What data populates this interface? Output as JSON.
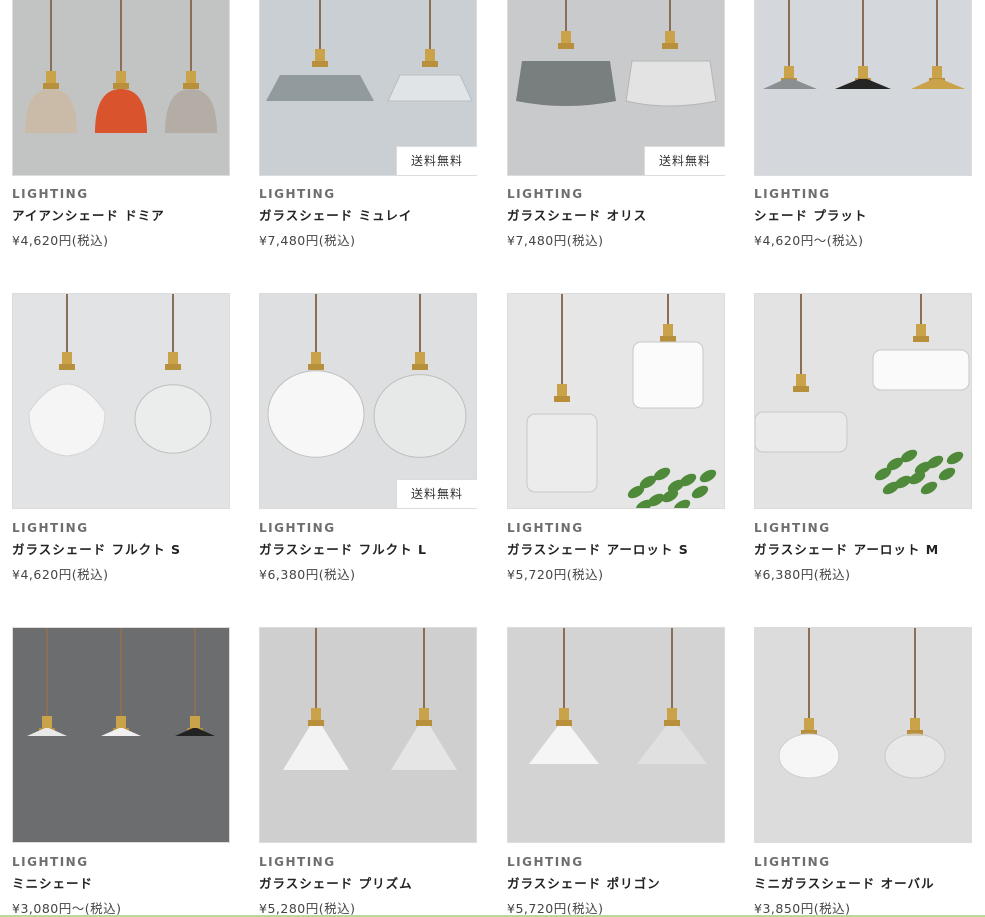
{
  "products": [
    {
      "category": "LIGHTING",
      "name": "アイアンシェード ドミア",
      "price": "¥4,620円(税込)",
      "badge": "",
      "scene": "iron",
      "bg": "#c2c4c4"
    },
    {
      "category": "LIGHTING",
      "name": "ガラスシェード ミュレイ",
      "price": "¥7,480円(税込)",
      "badge": "送料無料",
      "scene": "flat",
      "bg": "#c9cfd3"
    },
    {
      "category": "LIGHTING",
      "name": "ガラスシェード オリス",
      "price": "¥7,480円(税込)",
      "badge": "送料無料",
      "scene": "oris",
      "bg": "#c9cacc"
    },
    {
      "category": "LIGHTING",
      "name": "シェード プラット",
      "price": "¥4,620円〜(税込)",
      "badge": "",
      "scene": "plat",
      "bg": "#d4d8dc"
    },
    {
      "category": "LIGHTING",
      "name": "ガラスシェード フルクト S",
      "price": "¥4,620円(税込)",
      "badge": "",
      "scene": "frukt",
      "bg": "#e2e3e4"
    },
    {
      "category": "LIGHTING",
      "name": "ガラスシェード フルクト L",
      "price": "¥6,380円(税込)",
      "badge": "送料無料",
      "scene": "fruktl",
      "bg": "#dedfe0"
    },
    {
      "category": "LIGHTING",
      "name": "ガラスシェード アーロット S",
      "price": "¥5,720円(税込)",
      "badge": "",
      "scene": "arlot",
      "bg": "#e6e6e6"
    },
    {
      "category": "LIGHTING",
      "name": "ガラスシェード アーロット M",
      "price": "¥6,380円(税込)",
      "badge": "",
      "scene": "arlotm",
      "bg": "#e3e3e3"
    },
    {
      "category": "LIGHTING",
      "name": "ミニシェード",
      "price": "¥3,080円〜(税込)",
      "badge": "",
      "scene": "mini",
      "bg": "#6c6d6e"
    },
    {
      "category": "LIGHTING",
      "name": "ガラスシェード プリズム",
      "price": "¥5,280円(税込)",
      "badge": "",
      "scene": "prism",
      "bg": "#cfcfcf"
    },
    {
      "category": "LIGHTING",
      "name": "ガラスシェード ポリゴン",
      "price": "¥5,720円(税込)",
      "badge": "",
      "scene": "polygon",
      "bg": "#d4d3d3"
    },
    {
      "category": "LIGHTING",
      "name": "ミニガラスシェード オーバル",
      "price": "¥3,850円(税込)",
      "badge": "",
      "scene": "oval",
      "bg": "#dcdcdc"
    }
  ]
}
